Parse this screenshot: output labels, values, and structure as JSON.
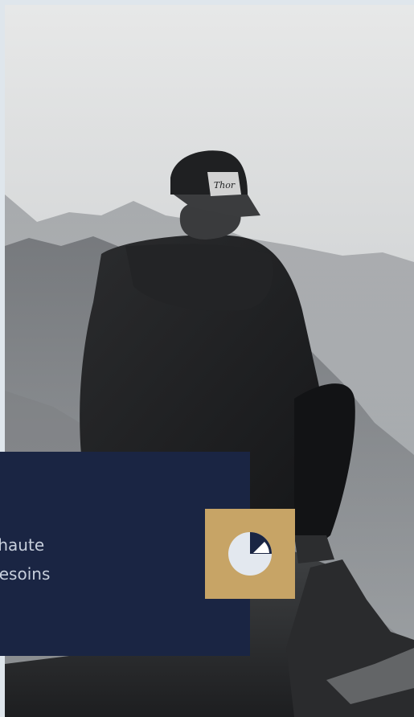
{
  "hero": {
    "photo": "hiker-on-mountain-summit",
    "cap_text": "Thor"
  },
  "info_card": {
    "line_1": "iques de haute",
    "line_2": "tés aux besoins"
  },
  "feature_icon": {
    "icon": "pie-chart-icon"
  },
  "colors": {
    "panel_navy": "#1a2543",
    "tile_gold": "#c7a466",
    "pie_light": "#e3e8ef",
    "page_bg": "#dfe6ec"
  }
}
